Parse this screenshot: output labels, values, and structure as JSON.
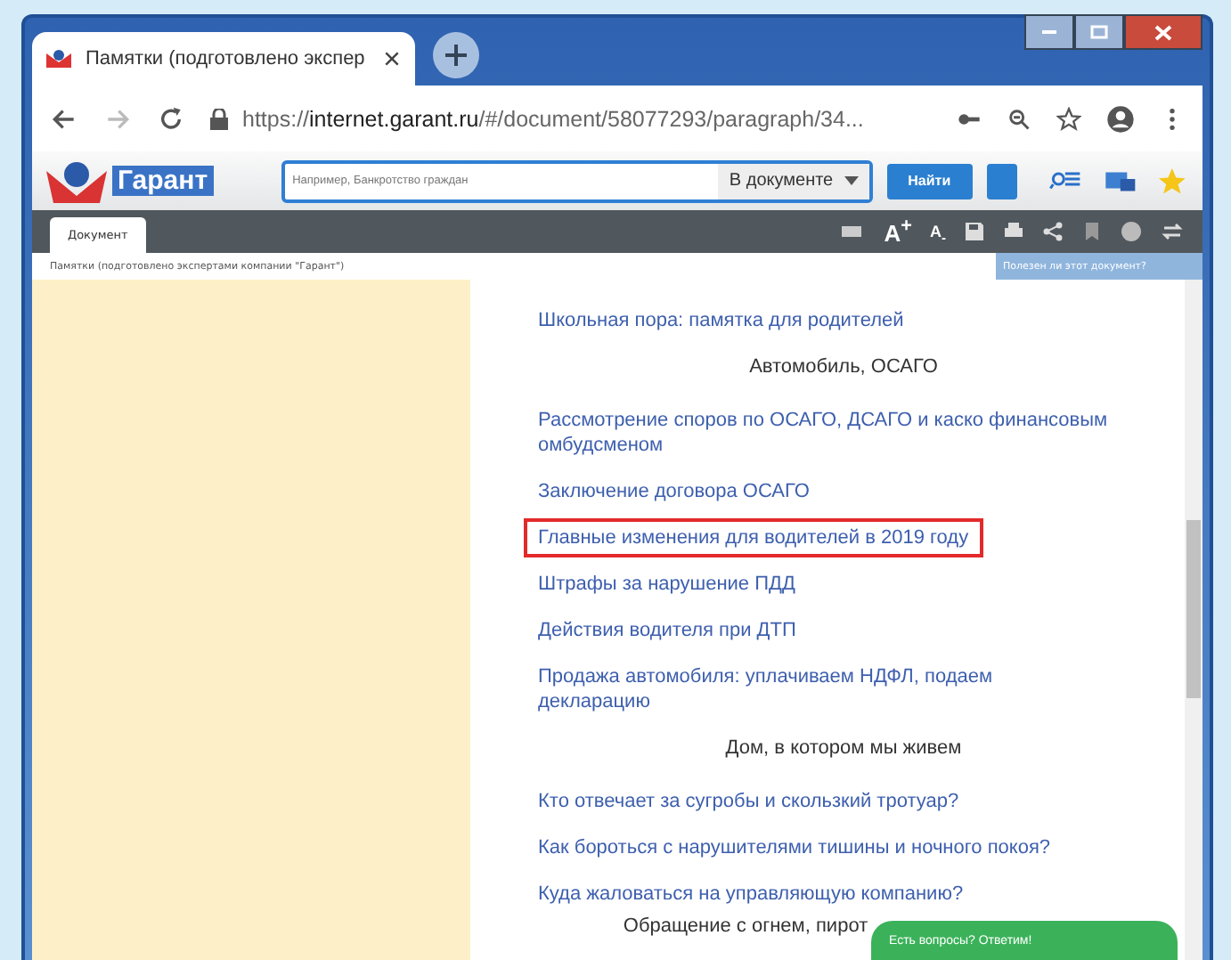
{
  "browser": {
    "tab_title": "Памятки (подготовлено экспер",
    "url_prefix": "https://",
    "url_host": "internet.garant.ru",
    "url_rest": "/#/document/58077293/paragraph/34..."
  },
  "toolbar": {
    "logo_text": "Гарант",
    "search_placeholder": "Например, Банкротство граждан",
    "scope": "В документе",
    "find_button": "Найти"
  },
  "doc_bar": {
    "tabs": [
      {
        "label": "Документ",
        "selected": true
      }
    ],
    "font_buttons": [
      "A$^{+}$",
      "A$_{-}$"
    ]
  },
  "breadcrumb": "Памятки (подготовлено экспертами компании \"Гарант\")",
  "feedback": "Полезен ли этот документ?",
  "items": [
    {
      "kind": "link",
      "text": "Школьная пора: памятка для родителей",
      "highlighted": false
    },
    {
      "kind": "heading",
      "text": "Автомобиль, ОСАГО"
    },
    {
      "kind": "link",
      "text": "Рассмотрение споров по ОСАГО, ДСАГО и каско финансовым омбудсменом",
      "highlighted": false
    },
    {
      "kind": "link",
      "text": "Заключение договора ОСАГО",
      "highlighted": false
    },
    {
      "kind": "link",
      "text": "Главные изменения для водителей в 2019 году",
      "highlighted": true
    },
    {
      "kind": "link",
      "text": "Штрафы за нарушение ПДД",
      "highlighted": false
    },
    {
      "kind": "link",
      "text": "Действия водителя при ДТП",
      "highlighted": false
    },
    {
      "kind": "link",
      "text": "Продажа автомобиля: уплачиваем НДФЛ, подаем декларацию",
      "highlighted": false
    },
    {
      "kind": "heading",
      "text": "Дом, в котором мы живем"
    },
    {
      "kind": "link",
      "text": "Кто отвечает за сугробы и скользкий тротуар?",
      "highlighted": false
    },
    {
      "kind": "link",
      "text": "Как бороться с нарушителями тишины и ночного покоя?",
      "highlighted": false
    },
    {
      "kind": "link",
      "text": "Куда жаловаться на управляющую компанию?",
      "highlighted": false
    },
    {
      "kind": "heading",
      "text": "Обращение с огнем, пирот"
    }
  ],
  "chat_button": "Есть вопросы? Ответим!"
}
